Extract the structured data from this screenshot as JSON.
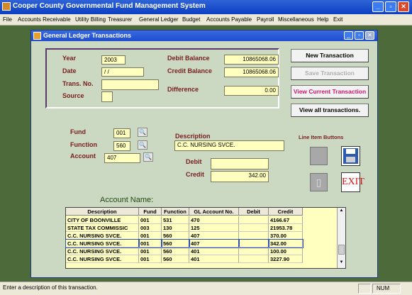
{
  "app": {
    "title": "Cooper County Governmental Fund Management System"
  },
  "menu": [
    "File",
    "Accounts Receivable",
    "Utility Billing",
    "Treasurer",
    "General Ledger",
    "Budget",
    "Accounts Payable",
    "Payroll",
    "Miscellaneous",
    "Help",
    "Exit"
  ],
  "window": {
    "title": "General Ledger Transactions"
  },
  "form": {
    "year_label": "Year",
    "year": "2003",
    "date_label": "Date",
    "date": " / /",
    "trans_label": "Trans. No.",
    "trans_no": "",
    "source_label": "Source",
    "source": "",
    "debit_balance_label": "Debit Balance",
    "debit_balance": "10865068.06",
    "credit_balance_label": "Credit Balance",
    "credit_balance": "10865068.06",
    "difference_label": "Difference",
    "difference": "0.00",
    "fund_label": "Fund",
    "fund": "001",
    "function_label": "Function",
    "function": "560",
    "account_label": "Account",
    "account": "407",
    "description_label": "Description",
    "description": "C.C. NURSING SVCE.",
    "debit_label": "Debit",
    "debit": "",
    "credit_label": "Credit",
    "credit": "342.00"
  },
  "buttons": {
    "new": "New Transaction",
    "save": "Save Transaction",
    "view_current": "View Current Transaction",
    "view_all": "View all transactions."
  },
  "line_item": {
    "label": "Line Item Buttons",
    "exit": "EXIT"
  },
  "account_name_label": "Account Name:",
  "grid": {
    "headers": [
      "Description",
      "Fund",
      "Function",
      "GL Account No.",
      "Debit",
      "Credit"
    ],
    "rows": [
      [
        "CITY OF BOONVILLE",
        "001",
        "531",
        "470",
        "",
        "4166.67"
      ],
      [
        "STATE TAX COMMISSIC",
        "003",
        "130",
        "125",
        "",
        "21953.78"
      ],
      [
        "C.C. NURSING SVCE.",
        "001",
        "560",
        "407",
        "",
        "370.00"
      ],
      [
        "C.C. NURSING SVCE.",
        "001",
        "560",
        "407",
        "",
        "342.00"
      ],
      [
        "C.C. NURSING SVCE.",
        "001",
        "560",
        "401",
        "",
        "100.00"
      ],
      [
        "C.C. NURSING SVCE.",
        "001",
        "560",
        "401",
        "",
        "3227.90"
      ]
    ],
    "selected_row": 3
  },
  "status": {
    "text": "Enter a description of this transaction.",
    "num": "NUM"
  },
  "colors": {
    "field_bg": "#ffffc0",
    "label": "#7a2020",
    "accent": "#d01870"
  }
}
